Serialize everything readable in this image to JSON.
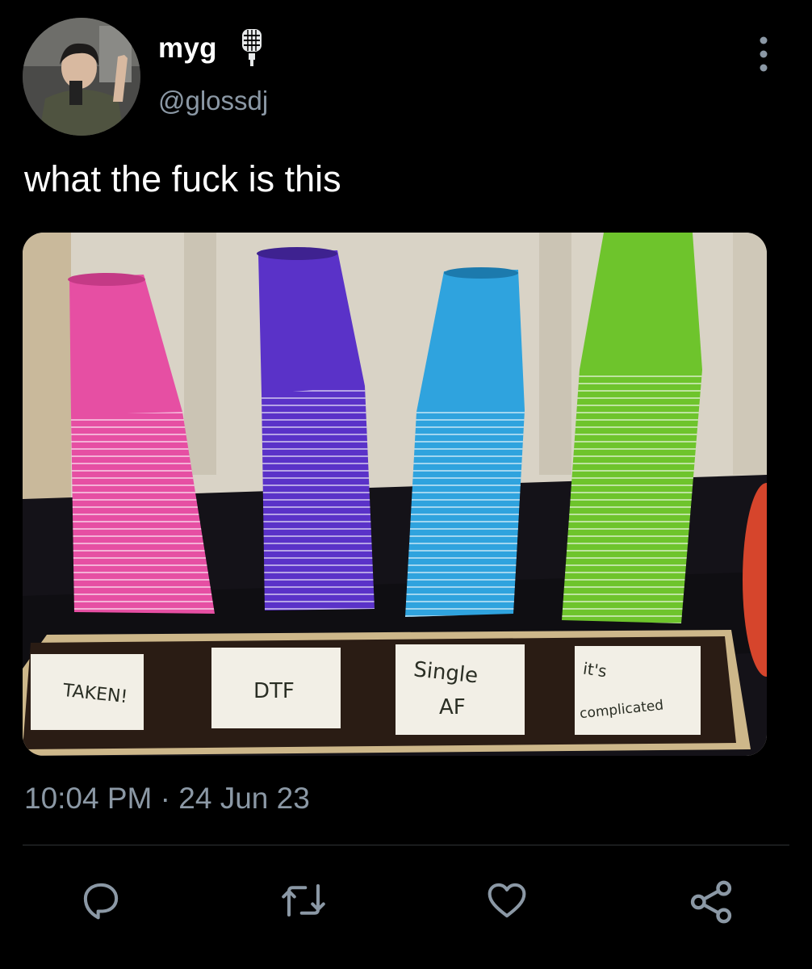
{
  "tweet": {
    "display_name": "myg",
    "handle": "@glossdj",
    "text": "what the fuck is this",
    "time": "10:04 PM",
    "separator": "·",
    "date": "24 Jun 23"
  },
  "media": {
    "cup_labels": [
      "TAKEN!",
      "DTF",
      "Single",
      "AF",
      "it's",
      "complicated"
    ],
    "cup_colors": [
      "#e64fa3",
      "#5a32c8",
      "#2fa3de",
      "#6ec42c"
    ]
  },
  "icons": {
    "badge": "microphone-icon",
    "menu": "more-vertical-icon",
    "actions": [
      "reply-icon",
      "retweet-icon",
      "like-icon",
      "share-icon"
    ]
  }
}
